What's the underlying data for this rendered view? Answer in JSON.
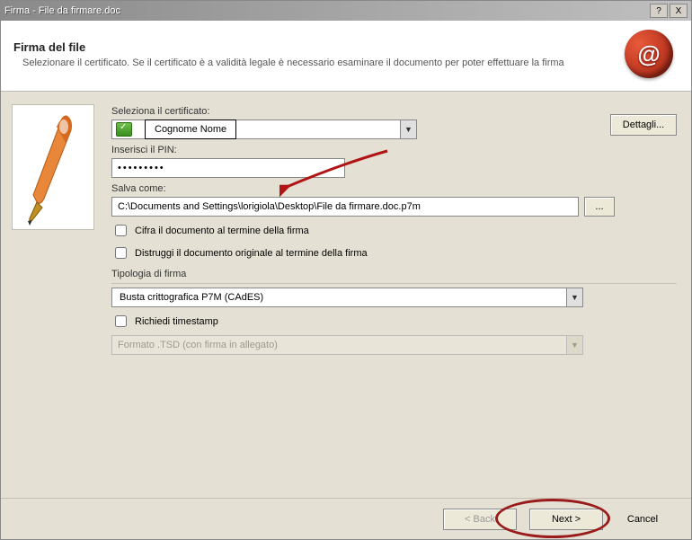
{
  "window": {
    "title": "Firma - File da firmare.doc"
  },
  "titlebar": {
    "help": "?",
    "close": "X"
  },
  "header": {
    "title": "Firma del file",
    "subtitle": "Selezionare il certificato. Se il certificato è a validità legale è necessario esaminare il documento per poter effettuare la firma"
  },
  "labels": {
    "select_cert": "Seleziona il certificato:",
    "enter_pin": "Inserisci il PIN:",
    "save_as": "Salva come:",
    "sign_type": "Tipologia di firma"
  },
  "fields": {
    "cert_value": "Cognome Nome",
    "pin_mask": "•••••••••",
    "save_path": "C:\\Documents and Settings\\lorigiola\\Desktop\\File da firmare.doc.p7m",
    "sign_type_value": "Busta crittografica P7M (CAdES)",
    "tsd_disabled": "Formato .TSD (con firma in allegato)"
  },
  "buttons": {
    "details": "Dettagli...",
    "browse": "...",
    "back": "< Back",
    "next": "Next >",
    "cancel": "Cancel"
  },
  "checkboxes": {
    "encrypt_after": "Cifra il documento al termine della firma",
    "destroy_original": "Distruggi il documento originale al termine della firma",
    "request_timestamp": "Richiedi timestamp"
  }
}
